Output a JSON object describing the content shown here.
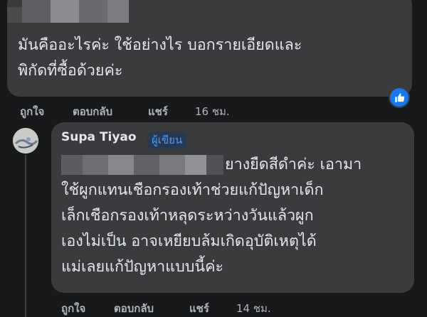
{
  "comment1": {
    "line1": "มันคืออะไรค่ะ ใช้อย่างไร บอกรายเอียดและ",
    "line2": "พิกัดที่ซื้อด้วยค่ะ",
    "actions": {
      "like": "ถูกใจ",
      "reply": "ตอบกลับ",
      "share": "แชร์",
      "time": "16 ชม."
    },
    "reaction_icon": "thumbs-up-icon"
  },
  "comment2": {
    "author": "Supa Tiyao",
    "badge": "ผู้เขียน",
    "line1": "ยางยืดสีดำค่ะ เอามา",
    "line2": "ใช้ผูกแทนเชือกรองเท้าช่วยแก้ปัญหาเด็ก",
    "line3": "เล็กเชือกรองเท้าหลุดระหว่างวันแล้วผูก",
    "line4": "เองไม่เป็น อาจเหยียบล้มเกิดอุบัติเหตุได้",
    "line5": "แม่เลยแก้ปัญหาแบบนี้ค่ะ",
    "actions": {
      "like": "ถูกใจ",
      "reply": "ตอบกลับ",
      "share": "แชร์",
      "time": "14 ชม."
    }
  },
  "colors": {
    "background": "#18191a",
    "bubble": "#3a3b3c",
    "text": "#e4e6eb",
    "secondary": "#b0b3b8",
    "accent": "#1877f2",
    "badge_text": "#4599ff"
  }
}
